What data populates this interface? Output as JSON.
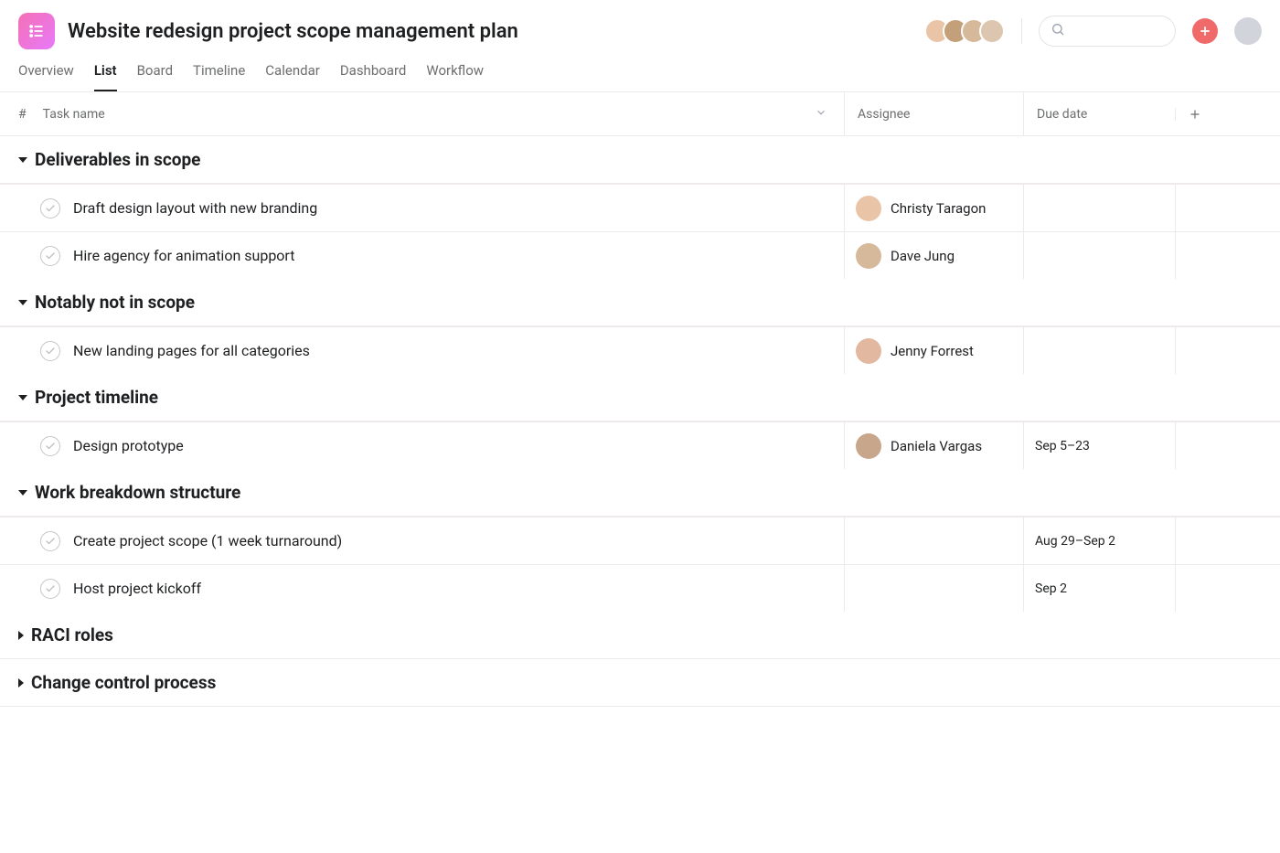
{
  "project": {
    "title": "Website redesign project scope management plan"
  },
  "tabs": [
    {
      "label": "Overview",
      "active": false
    },
    {
      "label": "List",
      "active": true
    },
    {
      "label": "Board",
      "active": false
    },
    {
      "label": "Timeline",
      "active": false
    },
    {
      "label": "Calendar",
      "active": false
    },
    {
      "label": "Dashboard",
      "active": false
    },
    {
      "label": "Workflow",
      "active": false
    }
  ],
  "columns": {
    "number": "#",
    "task_name": "Task name",
    "assignee": "Assignee",
    "due_date": "Due date"
  },
  "avatars": {
    "colors": [
      "#e9c4a7",
      "#c4a07a",
      "#d6b89a",
      "#dcc6b0"
    ]
  },
  "sections": [
    {
      "title": "Deliverables in scope",
      "expanded": true,
      "tasks": [
        {
          "name": "Draft design layout with new branding",
          "assignee": "Christy Taragon",
          "assignee_color": "#e9c4a7",
          "due": ""
        },
        {
          "name": "Hire agency for animation support",
          "assignee": "Dave Jung",
          "assignee_color": "#d6b89a",
          "due": ""
        }
      ]
    },
    {
      "title": "Notably not in scope",
      "expanded": true,
      "tasks": [
        {
          "name": "New landing pages for all categories",
          "assignee": "Jenny Forrest",
          "assignee_color": "#e2b8a0",
          "due": ""
        }
      ]
    },
    {
      "title": "Project timeline",
      "expanded": true,
      "tasks": [
        {
          "name": "Design prototype",
          "assignee": "Daniela Vargas",
          "assignee_color": "#c7a68c",
          "due": "Sep 5–23"
        }
      ]
    },
    {
      "title": "Work breakdown structure",
      "expanded": true,
      "tasks": [
        {
          "name": "Create project scope (1 week turnaround)",
          "assignee": "",
          "assignee_color": "",
          "due": "Aug 29–Sep 2"
        },
        {
          "name": "Host project kickoff",
          "assignee": "",
          "assignee_color": "",
          "due": "Sep 2"
        }
      ]
    },
    {
      "title": "RACI roles",
      "expanded": false,
      "tasks": []
    },
    {
      "title": "Change control process",
      "expanded": false,
      "tasks": []
    }
  ],
  "search": {
    "placeholder": ""
  },
  "icons": {
    "plus": "+"
  }
}
